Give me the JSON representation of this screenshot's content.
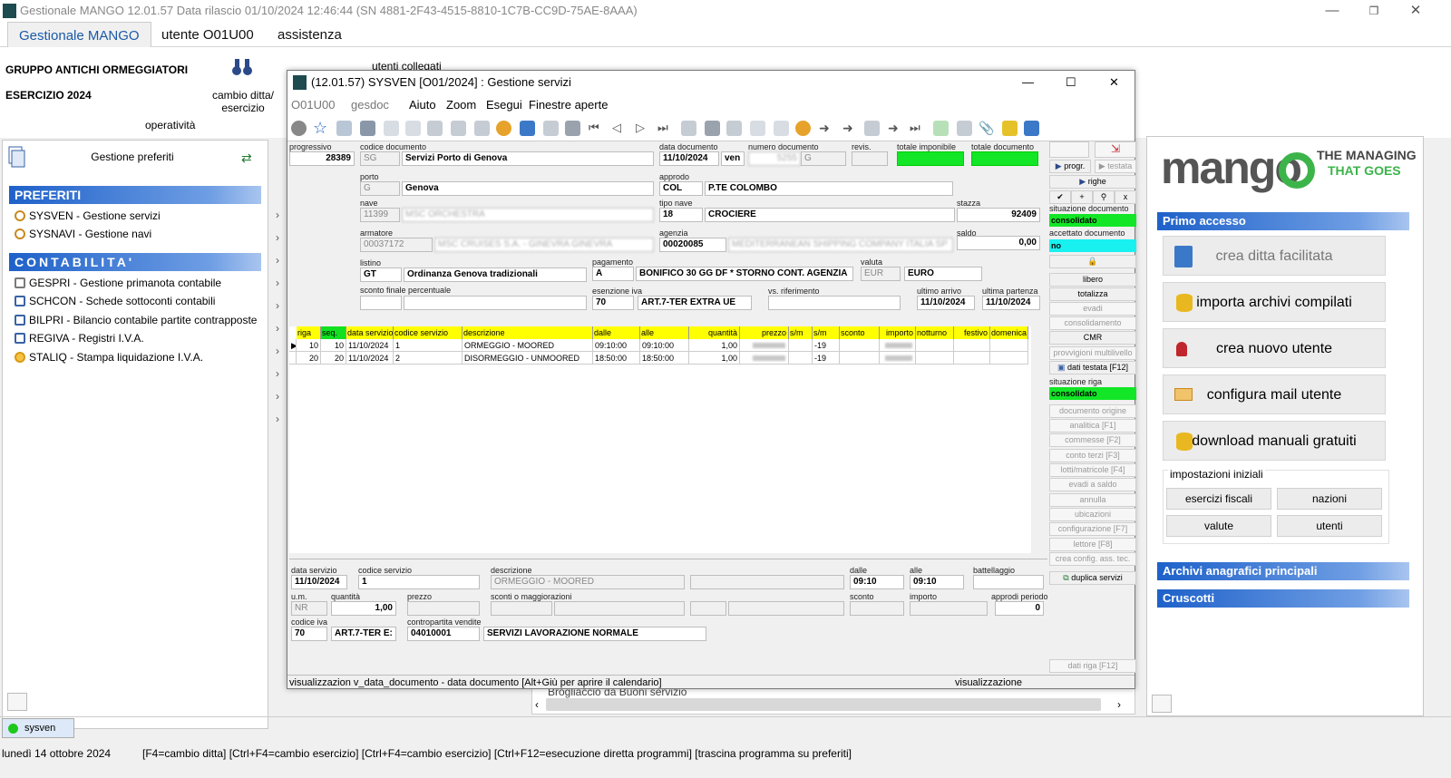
{
  "app": {
    "title": "Gestionale MANGO 12.01.57   Data rilascio 01/10/2024 12:46:44  (SN 4881-2F43-4515-8810-1C7B-CC9D-75AE-8AAA)",
    "tabs": [
      "Gestionale MANGO",
      "utente O01U00",
      "assistenza"
    ]
  },
  "ribbon": {
    "company": "GRUPPO ANTICHI ORMEGGIATORI",
    "year": "ESERCIZIO 2024",
    "change_label": "cambio ditta/\nesercizio",
    "operativity": "operatività",
    "connected_users": "utenti collegati"
  },
  "left": {
    "favorites_btn": "Gestione preferiti",
    "sec_preferiti": "PREFERITI",
    "sec_contabilita": "CONTABILITA'",
    "preferiti": [
      "SYSVEN - Gestione servizi",
      "SYSNAVI - Gestione navi"
    ],
    "contabilita": [
      "GESPRI - Gestione primanota contabile",
      "SCHCON - Schede sottoconti contabili",
      "BILPRI - Bilancio contabile partite contrapposte",
      "REGIVA - Registri I.V.A.",
      "STALIQ - Stampa liquidazione I.V.A."
    ]
  },
  "win": {
    "title": "(12.01.57) SYSVEN [O01/2024] : Gestione servizi",
    "menu": [
      "O01U00",
      "gesdoc",
      "Aiuto",
      "Zoom",
      "Esegui",
      "Finestre aperte"
    ],
    "labels": {
      "progressivo": "progressivo",
      "codice_documento": "codice documento",
      "data_documento": "data documento",
      "numero_documento": "numero documento",
      "revis": "revis.",
      "totale_imponibile": "totale imponibile",
      "totale_documento": "totale documento",
      "porto": "porto",
      "approdo": "approdo",
      "nave": "nave",
      "tipo_nave": "tipo nave",
      "stazza": "stazza",
      "armatore": "armatore",
      "agenzia": "agenzia",
      "saldo": "saldo",
      "listino": "listino",
      "pagamento": "pagamento",
      "valuta": "valuta",
      "sconto_finale": "sconto finale percentuale",
      "esenzione_iva": "esenzione iva",
      "vs_riferimento": "vs. riferimento",
      "ultimo_arrivo": "ultimo arrivo",
      "ultima_partenza": "ultima partenza"
    },
    "values": {
      "progressivo": "28389",
      "codice_documento": "SG",
      "codice_documento_desc": "Servizi Porto di Genova",
      "data_documento": "11/10/2024",
      "giorno": "ven",
      "numero_documento": "5255",
      "numero_serie": "G",
      "porto": "G",
      "porto_desc": "Genova",
      "approdo": "COL",
      "approdo_desc": "P.TE COLOMBO",
      "nave": "11399",
      "nave_desc": "MSC ORCHESTRA",
      "tipo_nave": "18",
      "tipo_nave_desc": "CROCIERE",
      "stazza": "92409",
      "armatore": "00037172",
      "armatore_desc": "MSC CRUISES S.A. - GINEVRA GINEVRA",
      "agenzia": "00020085",
      "agenzia_desc": "MEDITERRANEAN SHIPPING COMPANY ITALIA SP",
      "saldo": "0,00",
      "listino": "GT",
      "listino_desc": "Ordinanza Genova tradizionali",
      "pagamento": "A",
      "pagamento_desc": "BONIFICO 30 GG DF * STORNO CONT. AGENZIA",
      "valuta": "EUR",
      "valuta_desc": "EURO",
      "esenzione_iva": "70",
      "esenzione_iva_desc": "ART.7-TER EXTRA UE",
      "ultimo_arrivo": "11/10/2024",
      "ultima_partenza": "11/10/2024"
    },
    "grid": {
      "headers": [
        "riga",
        "seq.",
        "data servizio",
        "codice servizio",
        "descrizione",
        "dalle",
        "alle",
        "quantità",
        "prezzo",
        "s/m",
        "s/m",
        "sconto",
        "importo",
        "notturno",
        "festivo",
        "domenica"
      ],
      "rows": [
        [
          "10",
          "10",
          "11/10/2024",
          "1",
          "ORMEGGIO - MOORED",
          "09:10:00",
          "09:10:00",
          "1,00",
          "",
          "",
          "-19",
          "",
          "",
          "",
          "",
          ""
        ],
        [
          "20",
          "20",
          "11/10/2024",
          "2",
          "DISORMEGGIO - UNMOORED",
          "18:50:00",
          "18:50:00",
          "1,00",
          "",
          "",
          "-19",
          "",
          "",
          "",
          "",
          ""
        ]
      ]
    },
    "side": {
      "progr": "progr.",
      "testata": "testata",
      "righe": "righe",
      "situazione_documento": "situazione documento",
      "situazione_documento_val": "consolidato",
      "accettato_documento": "accettato documento",
      "accettato_documento_val": "no",
      "buttons_a": [
        "libero",
        "totalizza",
        "evadi",
        "consolidamento",
        "CMR",
        "provvigioni multilivello",
        "dati testata [F12]"
      ],
      "situazione_riga": "situazione riga",
      "situazione_riga_val": "consolidato",
      "buttons_b": [
        "documento origine",
        "analitica [F1]",
        "commesse [F2]",
        "conto terzi [F3]",
        "lotti/matricole [F4]",
        "evadi a saldo",
        "annulla",
        "ubicazioni",
        "configurazione [F7]",
        "lettore [F8]",
        "crea config. ass. tec."
      ],
      "duplica": "duplica servizi",
      "dati_riga": "dati riga [F12]"
    },
    "detail": {
      "data_servizio_l": "data servizio",
      "data_servizio": "11/10/2024",
      "codice_servizio_l": "codice servizio",
      "codice_servizio": "1",
      "descrizione_l": "descrizione",
      "descrizione": "ORMEGGIO - MOORED",
      "dalle_l": "dalle",
      "dalle": "09:10",
      "alle_l": "alle",
      "alle": "09:10",
      "battellaggio_l": "battellaggio",
      "um_l": "u.m.",
      "um": "NR",
      "quantita_l": "quantità",
      "quantita": "1,00",
      "prezzo_l": "prezzo",
      "sconti_l": "sconti o maggiorazioni",
      "sconto_l": "sconto",
      "importo_l": "importo",
      "approdi_l": "approdi periodo",
      "approdi": "0",
      "codice_iva_l": "codice iva",
      "codice_iva": "70",
      "codice_iva_desc": "ART.7-TER E:",
      "contropartita_l": "contropartita vendite",
      "contropartita": "04010001",
      "contropartita_desc": "SERVIZI LAVORAZIONE NORMALE"
    },
    "status_left": "visualizzazion v_data_documento - data documento [Alt+Giù per aprire il calendario]",
    "status_right": "visualizzazione"
  },
  "right": {
    "brand": "mango",
    "slogan1": "THE MANAGING",
    "slogan2": "THAT GOES",
    "primo_accesso": "Primo accesso",
    "big": [
      "crea ditta facilitata",
      "importa archivi compilati",
      "crea nuovo utente",
      "configura mail utente",
      "download manuali gratuiti"
    ],
    "impostazioni": "impostazioni iniziali",
    "small": [
      "esercizi fiscali",
      "nazioni",
      "valute",
      "utenti"
    ],
    "archivi": "Archivi anagrafici principali",
    "cruscotti": "Cruscotti"
  },
  "bg_text": "Brogliaccio da Buoni servizio",
  "taskbar": {
    "item": "sysven"
  },
  "status": {
    "date": "lunedì 14 ottobre 2024",
    "hints": "[F4=cambio ditta] [Ctrl+F4=cambio esercizio] [Ctrl+F4=cambio esercizio] [Ctrl+F12=esecuzione diretta programmi] [trascina programma su preferiti]"
  },
  "colors": {
    "accent": "#1e61c9",
    "green": "#12e626",
    "cyan": "#19f0f0",
    "yellow": "#ffff00"
  }
}
